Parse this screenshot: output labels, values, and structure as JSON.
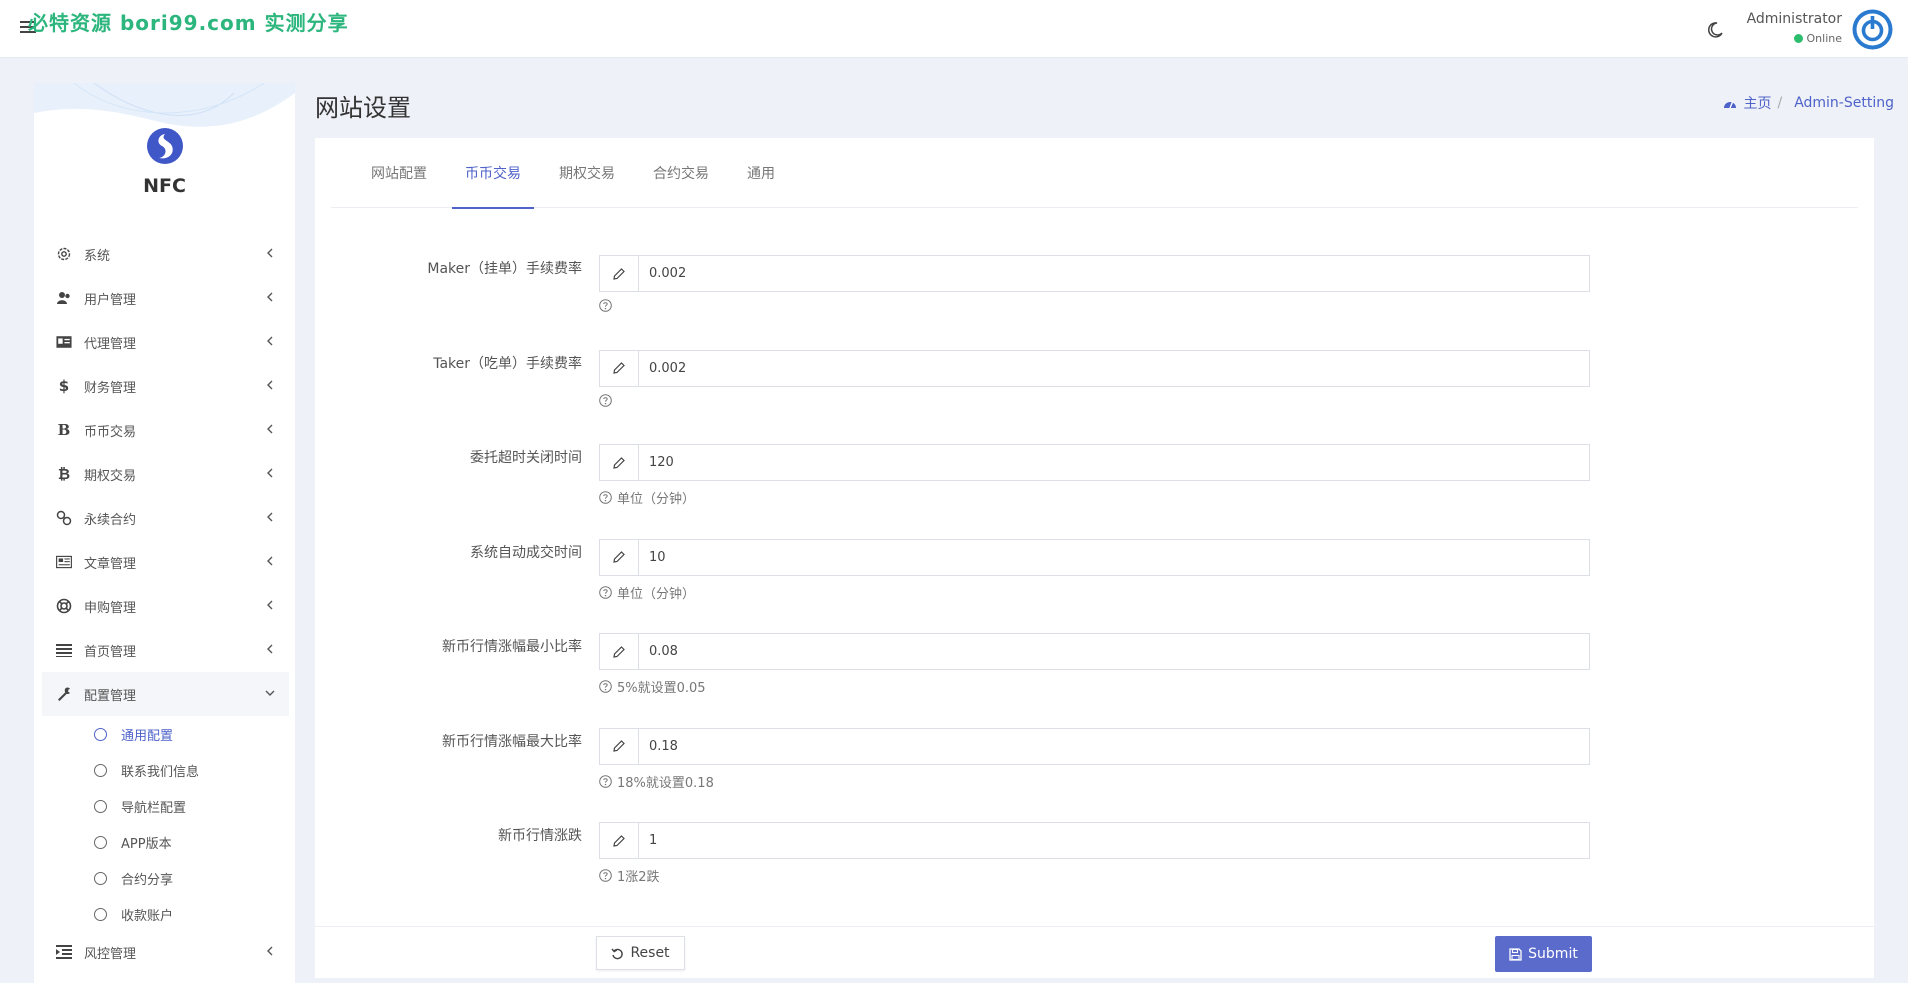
{
  "header": {
    "watermark": "必特资源 bori99.com 实测分享",
    "user_name": "Administrator",
    "user_status": "Online"
  },
  "sidebar": {
    "brand": "NFC",
    "items": [
      {
        "label": "系统",
        "icon": "gear-icon"
      },
      {
        "label": "用户管理",
        "icon": "users-icon"
      },
      {
        "label": "代理管理",
        "icon": "id-card-icon"
      },
      {
        "label": "财务管理",
        "icon": "dollar-icon"
      },
      {
        "label": "币币交易",
        "icon": "bold-b-icon"
      },
      {
        "label": "期权交易",
        "icon": "bitcoin-icon"
      },
      {
        "label": "永续合约",
        "icon": "link-icon"
      },
      {
        "label": "文章管理",
        "icon": "newspaper-icon"
      },
      {
        "label": "申购管理",
        "icon": "life-ring-icon"
      },
      {
        "label": "首页管理",
        "icon": "list-icon"
      },
      {
        "label": "配置管理",
        "icon": "wrench-icon"
      }
    ],
    "submenu": [
      {
        "label": "通用配置"
      },
      {
        "label": "联系我们信息"
      },
      {
        "label": "导航栏配置"
      },
      {
        "label": "APP版本"
      },
      {
        "label": "合约分享"
      },
      {
        "label": "收款账户"
      }
    ],
    "last_item": {
      "label": "风控管理",
      "icon": "indent-icon"
    }
  },
  "page": {
    "title": "网站设置",
    "breadcrumb_home": "主页",
    "breadcrumb_current": "Admin-Setting"
  },
  "tabs": [
    "网站配置",
    "币币交易",
    "期权交易",
    "合约交易",
    "通用"
  ],
  "form": {
    "fields": [
      {
        "label": "Maker（挂单）手续费率",
        "value": "0.002",
        "help": ""
      },
      {
        "label": "Taker（吃单）手续费率",
        "value": "0.002",
        "help": ""
      },
      {
        "label": "委托超时关闭时间",
        "value": "120",
        "help": "单位（分钟）"
      },
      {
        "label": "系统自动成交时间",
        "value": "10",
        "help": "单位（分钟）"
      },
      {
        "label": "新币行情涨幅最小比率",
        "value": "0.08",
        "help": "5%就设置0.05"
      },
      {
        "label": "新币行情涨幅最大比率",
        "value": "0.18",
        "help": "18%就设置0.18"
      },
      {
        "label": "新币行情涨跌",
        "value": "1",
        "help": "1涨2跌"
      }
    ],
    "reset_label": "Reset",
    "submit_label": "Submit"
  },
  "colors": {
    "accent": "#4e62c9",
    "submit": "#5b6bcb",
    "online": "#2dbd6e",
    "watermark": "#2cb67d"
  }
}
